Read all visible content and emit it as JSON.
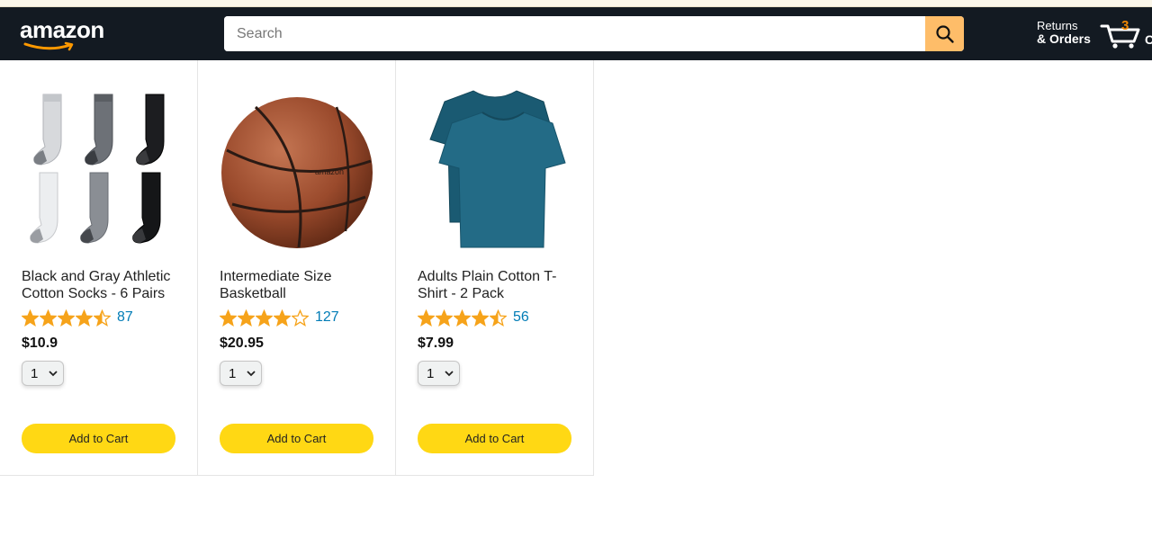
{
  "header": {
    "logo_text": "amazon",
    "search": {
      "placeholder": "Search",
      "value": ""
    },
    "orders": {
      "line1": "Returns",
      "line2": "& Orders"
    },
    "cart": {
      "count": "3",
      "label": "C"
    }
  },
  "colors": {
    "header_bg": "#131a22",
    "search_button": "#febd69",
    "cart_count": "#f08804",
    "add_button": "#ffd814",
    "star": "#f6a31a",
    "rating_count": "#017cb6"
  },
  "products": [
    {
      "name": "Black and Gray Athletic Cotton Socks - 6 Pairs",
      "rating": 4.5,
      "rating_count": "87",
      "price": "$10.9",
      "quantity": "1",
      "add_label": "Add to Cart",
      "image": "socks-image"
    },
    {
      "name": "Intermediate Size Basketball",
      "rating": 4.0,
      "rating_count": "127",
      "price": "$20.95",
      "quantity": "1",
      "add_label": "Add to Cart",
      "image": "basketball-image"
    },
    {
      "name": "Adults Plain Cotton T-Shirt - 2 Pack",
      "rating": 4.5,
      "rating_count": "56",
      "price": "$7.99",
      "quantity": "1",
      "add_label": "Add to Cart",
      "image": "tshirt-image"
    }
  ]
}
